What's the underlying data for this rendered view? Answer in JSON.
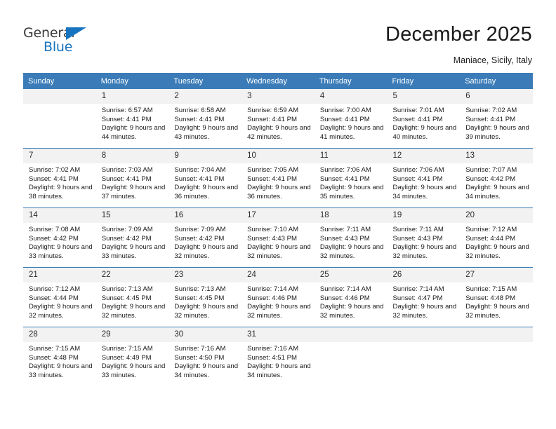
{
  "logo": {
    "line1": "General",
    "line2": "Blue",
    "triangle_icon": "blue-triangle-icon",
    "color_dark": "#3b3b3b",
    "color_blue": "#1673bf"
  },
  "header": {
    "title": "December 2025",
    "subtitle": "Maniace, Sicily, Italy"
  },
  "theme": {
    "header_bg": "#3b7cb8",
    "header_text": "#ffffff",
    "daynum_bg": "#f2f2f2",
    "cell_bg": "#ffffff",
    "rule": "#3b7cb8"
  },
  "weekday_headers": [
    "Sunday",
    "Monday",
    "Tuesday",
    "Wednesday",
    "Thursday",
    "Friday",
    "Saturday"
  ],
  "weeks": [
    [
      {
        "day": "",
        "empty": true,
        "sunrise": "",
        "sunset": "",
        "daylight": ""
      },
      {
        "day": "1",
        "sunrise": "Sunrise: 6:57 AM",
        "sunset": "Sunset: 4:41 PM",
        "daylight": "Daylight: 9 hours and 44 minutes."
      },
      {
        "day": "2",
        "sunrise": "Sunrise: 6:58 AM",
        "sunset": "Sunset: 4:41 PM",
        "daylight": "Daylight: 9 hours and 43 minutes."
      },
      {
        "day": "3",
        "sunrise": "Sunrise: 6:59 AM",
        "sunset": "Sunset: 4:41 PM",
        "daylight": "Daylight: 9 hours and 42 minutes."
      },
      {
        "day": "4",
        "sunrise": "Sunrise: 7:00 AM",
        "sunset": "Sunset: 4:41 PM",
        "daylight": "Daylight: 9 hours and 41 minutes."
      },
      {
        "day": "5",
        "sunrise": "Sunrise: 7:01 AM",
        "sunset": "Sunset: 4:41 PM",
        "daylight": "Daylight: 9 hours and 40 minutes."
      },
      {
        "day": "6",
        "sunrise": "Sunrise: 7:02 AM",
        "sunset": "Sunset: 4:41 PM",
        "daylight": "Daylight: 9 hours and 39 minutes."
      }
    ],
    [
      {
        "day": "7",
        "sunrise": "Sunrise: 7:02 AM",
        "sunset": "Sunset: 4:41 PM",
        "daylight": "Daylight: 9 hours and 38 minutes."
      },
      {
        "day": "8",
        "sunrise": "Sunrise: 7:03 AM",
        "sunset": "Sunset: 4:41 PM",
        "daylight": "Daylight: 9 hours and 37 minutes."
      },
      {
        "day": "9",
        "sunrise": "Sunrise: 7:04 AM",
        "sunset": "Sunset: 4:41 PM",
        "daylight": "Daylight: 9 hours and 36 minutes."
      },
      {
        "day": "10",
        "sunrise": "Sunrise: 7:05 AM",
        "sunset": "Sunset: 4:41 PM",
        "daylight": "Daylight: 9 hours and 36 minutes."
      },
      {
        "day": "11",
        "sunrise": "Sunrise: 7:06 AM",
        "sunset": "Sunset: 4:41 PM",
        "daylight": "Daylight: 9 hours and 35 minutes."
      },
      {
        "day": "12",
        "sunrise": "Sunrise: 7:06 AM",
        "sunset": "Sunset: 4:41 PM",
        "daylight": "Daylight: 9 hours and 34 minutes."
      },
      {
        "day": "13",
        "sunrise": "Sunrise: 7:07 AM",
        "sunset": "Sunset: 4:42 PM",
        "daylight": "Daylight: 9 hours and 34 minutes."
      }
    ],
    [
      {
        "day": "14",
        "sunrise": "Sunrise: 7:08 AM",
        "sunset": "Sunset: 4:42 PM",
        "daylight": "Daylight: 9 hours and 33 minutes."
      },
      {
        "day": "15",
        "sunrise": "Sunrise: 7:09 AM",
        "sunset": "Sunset: 4:42 PM",
        "daylight": "Daylight: 9 hours and 33 minutes."
      },
      {
        "day": "16",
        "sunrise": "Sunrise: 7:09 AM",
        "sunset": "Sunset: 4:42 PM",
        "daylight": "Daylight: 9 hours and 32 minutes."
      },
      {
        "day": "17",
        "sunrise": "Sunrise: 7:10 AM",
        "sunset": "Sunset: 4:43 PM",
        "daylight": "Daylight: 9 hours and 32 minutes."
      },
      {
        "day": "18",
        "sunrise": "Sunrise: 7:11 AM",
        "sunset": "Sunset: 4:43 PM",
        "daylight": "Daylight: 9 hours and 32 minutes."
      },
      {
        "day": "19",
        "sunrise": "Sunrise: 7:11 AM",
        "sunset": "Sunset: 4:43 PM",
        "daylight": "Daylight: 9 hours and 32 minutes."
      },
      {
        "day": "20",
        "sunrise": "Sunrise: 7:12 AM",
        "sunset": "Sunset: 4:44 PM",
        "daylight": "Daylight: 9 hours and 32 minutes."
      }
    ],
    [
      {
        "day": "21",
        "sunrise": "Sunrise: 7:12 AM",
        "sunset": "Sunset: 4:44 PM",
        "daylight": "Daylight: 9 hours and 32 minutes."
      },
      {
        "day": "22",
        "sunrise": "Sunrise: 7:13 AM",
        "sunset": "Sunset: 4:45 PM",
        "daylight": "Daylight: 9 hours and 32 minutes."
      },
      {
        "day": "23",
        "sunrise": "Sunrise: 7:13 AM",
        "sunset": "Sunset: 4:45 PM",
        "daylight": "Daylight: 9 hours and 32 minutes."
      },
      {
        "day": "24",
        "sunrise": "Sunrise: 7:14 AM",
        "sunset": "Sunset: 4:46 PM",
        "daylight": "Daylight: 9 hours and 32 minutes."
      },
      {
        "day": "25",
        "sunrise": "Sunrise: 7:14 AM",
        "sunset": "Sunset: 4:46 PM",
        "daylight": "Daylight: 9 hours and 32 minutes."
      },
      {
        "day": "26",
        "sunrise": "Sunrise: 7:14 AM",
        "sunset": "Sunset: 4:47 PM",
        "daylight": "Daylight: 9 hours and 32 minutes."
      },
      {
        "day": "27",
        "sunrise": "Sunrise: 7:15 AM",
        "sunset": "Sunset: 4:48 PM",
        "daylight": "Daylight: 9 hours and 32 minutes."
      }
    ],
    [
      {
        "day": "28",
        "sunrise": "Sunrise: 7:15 AM",
        "sunset": "Sunset: 4:48 PM",
        "daylight": "Daylight: 9 hours and 33 minutes."
      },
      {
        "day": "29",
        "sunrise": "Sunrise: 7:15 AM",
        "sunset": "Sunset: 4:49 PM",
        "daylight": "Daylight: 9 hours and 33 minutes."
      },
      {
        "day": "30",
        "sunrise": "Sunrise: 7:16 AM",
        "sunset": "Sunset: 4:50 PM",
        "daylight": "Daylight: 9 hours and 34 minutes."
      },
      {
        "day": "31",
        "sunrise": "Sunrise: 7:16 AM",
        "sunset": "Sunset: 4:51 PM",
        "daylight": "Daylight: 9 hours and 34 minutes."
      },
      {
        "day": "",
        "empty": true,
        "sunrise": "",
        "sunset": "",
        "daylight": ""
      },
      {
        "day": "",
        "empty": true,
        "sunrise": "",
        "sunset": "",
        "daylight": ""
      },
      {
        "day": "",
        "empty": true,
        "sunrise": "",
        "sunset": "",
        "daylight": ""
      }
    ]
  ]
}
